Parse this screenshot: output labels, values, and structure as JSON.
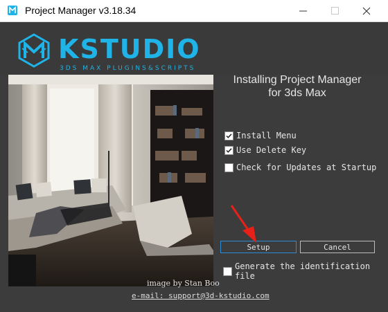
{
  "window": {
    "title": "Project Manager v3.18.34"
  },
  "logo": {
    "word": "KSTUDIO",
    "subtitle": "3DS MAX PLUGINS&SCRIPTS",
    "color": "#1fb3e8"
  },
  "install": {
    "title_line1": "Installing Project Manager",
    "title_line2": "for 3ds Max"
  },
  "options": [
    {
      "label": "Install Menu",
      "checked": true
    },
    {
      "label": "Use Delete Key",
      "checked": true
    },
    {
      "label": "Check for Updates at Startup",
      "checked": false
    },
    {
      "label": "Generate the identification file",
      "checked": false
    }
  ],
  "buttons": {
    "setup": "Setup",
    "cancel": "Cancel"
  },
  "footer": {
    "credit": "image by Stan Boo",
    "email": "e-mail: support@3d-kstudio.com"
  }
}
